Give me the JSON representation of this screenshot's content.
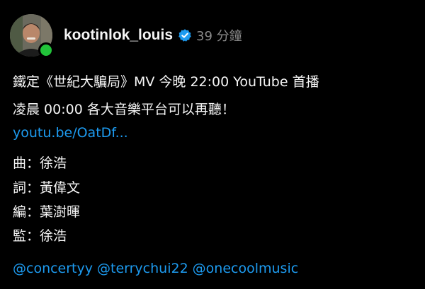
{
  "post": {
    "username": "kootinlok_louis",
    "timestamp": "39 分鐘",
    "lines": [
      "鐵定《世紀大騙局》MV 今晚 22:00 YouTube 首播",
      "凌晨 00:00 各大音樂平台可以再聽！"
    ],
    "link": "youtu.be/OatDf...",
    "credits": [
      "曲：徐浩",
      "詞：黃偉文",
      "編：葉澍暉",
      "監：徐浩"
    ],
    "mentions": [
      "@concertyy",
      "@terrychui22",
      "@onecoolmusic"
    ]
  },
  "colors": {
    "background": "#000000",
    "text": "#f5f5f5",
    "muted": "#8a8a8a",
    "link": "#1d9bf0",
    "verified": "#1d9bf0",
    "online": "#22c33a"
  },
  "icons": {
    "verified": "verified-badge-icon",
    "online": "online-status-icon"
  }
}
